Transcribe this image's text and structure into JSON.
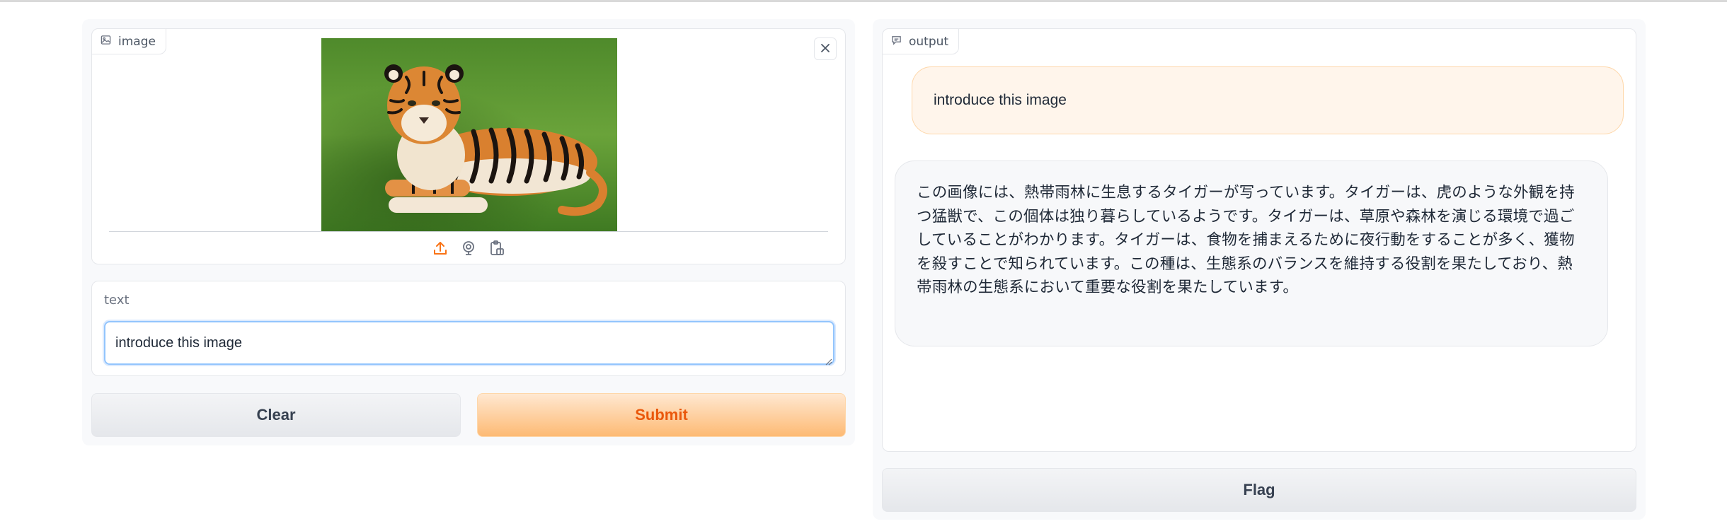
{
  "image_panel": {
    "label": "image",
    "label_icon": "image-icon",
    "close_icon": "close-icon",
    "sources": [
      "upload-icon",
      "webcam-icon",
      "clipboard-icon"
    ]
  },
  "text_panel": {
    "label": "text",
    "value": "introduce this image"
  },
  "buttons": {
    "clear": "Clear",
    "submit": "Submit",
    "flag": "Flag"
  },
  "output": {
    "label": "output",
    "label_icon": "chat-icon",
    "user_message": "introduce this image",
    "bot_message": "この画像には、熱帯雨林に生息するタイガーが写っています。タイガーは、虎のような外観を持つ猛獣で、この個体は独り暮らしているようです。タイガーは、草原や森林を演じる環境で過ごしていることがわかります。タイガーは、食物を捕まえるために夜行動をすることが多く、獲物を殺すことで知られています。この種は、生態系のバランスを維持する役割を果たしており、熱帯雨林の生態系において重要な役割を果たしています。"
  },
  "colors": {
    "accent": "#ea580c",
    "submit_bg": "#fdba74",
    "focus_border": "#93c5fd"
  }
}
